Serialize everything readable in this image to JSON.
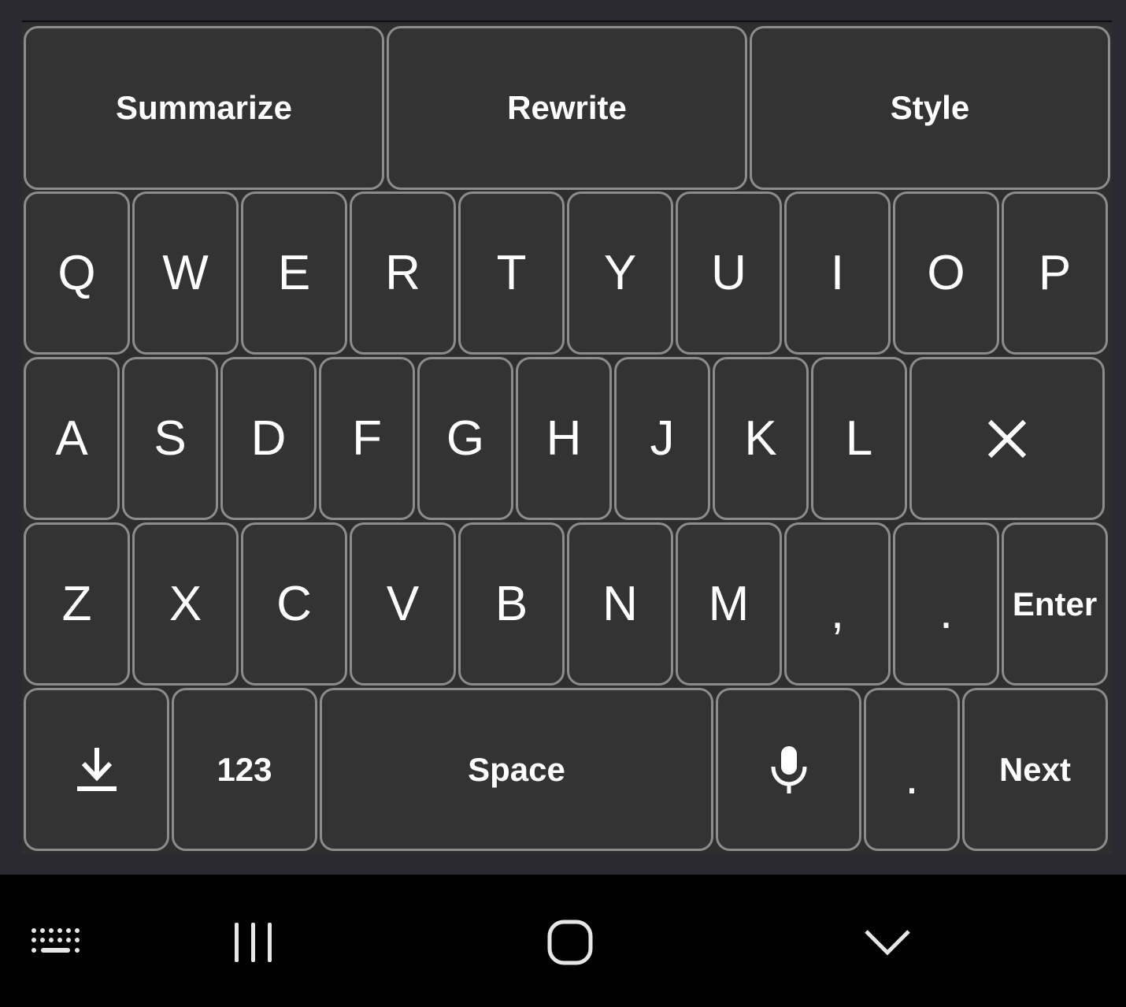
{
  "suggestion_bar": {
    "summarize_label": "Summarize",
    "rewrite_label": "Rewrite",
    "style_label": "Style"
  },
  "rows": {
    "row1": [
      "Q",
      "W",
      "E",
      "R",
      "T",
      "Y",
      "U",
      "I",
      "O",
      "P"
    ],
    "row2": [
      "A",
      "S",
      "D",
      "F",
      "G",
      "H",
      "J",
      "K",
      "L"
    ],
    "row3": [
      "Z",
      "X",
      "C",
      "V",
      "B",
      "N",
      "M",
      ",",
      ".",
      "Enter"
    ]
  },
  "bottom_row": {
    "numbers_label": "123",
    "space_label": "Space",
    "period_label": ".",
    "next_label": "Next"
  },
  "icons": {
    "backspace": "close-x-icon",
    "hide_keyboard": "download-arrow-icon",
    "voice": "microphone-icon",
    "nav_keyboard": "keyboard-icon",
    "nav_recents": "recents-icon",
    "nav_home": "home-icon",
    "nav_back": "chevron-down-icon"
  },
  "colors": {
    "key_background": "#333333",
    "key_border": "#8c8c8c",
    "key_text": "#ffffff",
    "nav_background": "#000000"
  }
}
